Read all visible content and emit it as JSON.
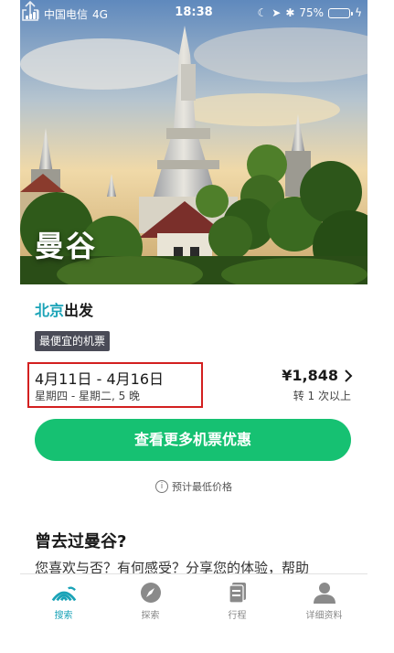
{
  "status_bar": {
    "carrier": "中国电信",
    "network": "4G",
    "time": "18:38",
    "battery_percent": "75%",
    "battery_level": 0.75
  },
  "hero": {
    "city": "曼谷"
  },
  "origin": {
    "city": "北京",
    "suffix": "出发"
  },
  "badge": "最便宜的机票",
  "trip": {
    "dates": "4月11日 - 4月16日",
    "weekdays": "星期四 - 星期二, 5 晚",
    "price": "¥1,848",
    "stops": "转 1 次以上"
  },
  "cta_label": "查看更多机票优惠",
  "note": "预计最低价格",
  "section": {
    "title": "曾去过曼谷?",
    "body": "您喜欢与否？有何感受？分享您的体验，帮助"
  },
  "tabs": [
    {
      "label": "搜索",
      "icon": "search-skyscanner-icon",
      "active": true
    },
    {
      "label": "探索",
      "icon": "compass-icon",
      "active": false
    },
    {
      "label": "行程",
      "icon": "trips-icon",
      "active": false
    },
    {
      "label": "详细资料",
      "icon": "profile-icon",
      "active": false
    }
  ],
  "colors": {
    "accent": "#1aa3b7",
    "cta": "#16c172",
    "highlight_border": "#d32020",
    "badge_bg": "#4a4b57"
  }
}
